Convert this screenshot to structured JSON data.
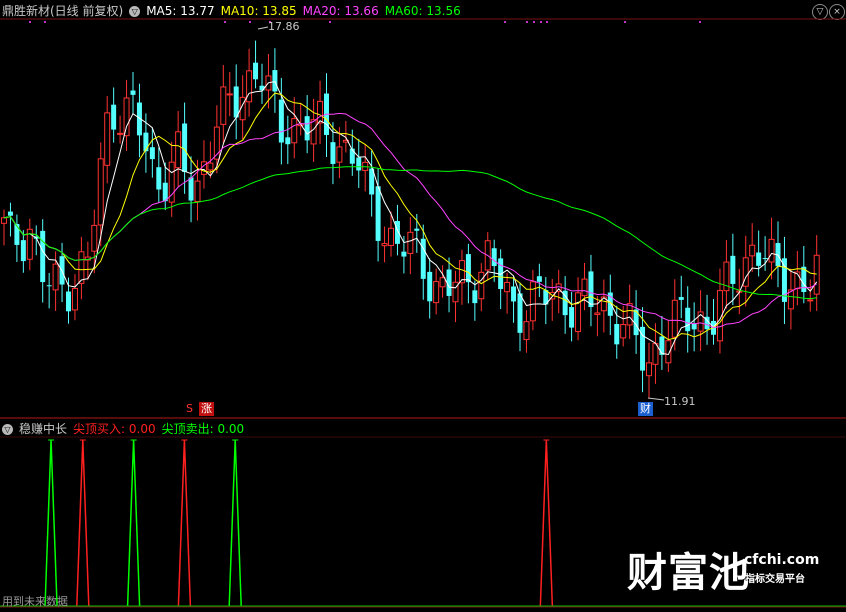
{
  "header": {
    "title": "鼎胜新材(日线 前复权)",
    "ma5": "MA5: 13.77",
    "ma10": "MA10: 13.85",
    "ma20": "MA20: 13.66",
    "ma60": "MA60: 13.56",
    "ma5_color": "#ffffff",
    "ma10_color": "#ffff00",
    "ma20_color": "#ff44ff",
    "ma60_color": "#00ff00"
  },
  "controls": {
    "close_icon": "×",
    "dropdown_icon": "▽"
  },
  "annotations": {
    "high": "17.86",
    "low": "11.91",
    "zhang_badge": "涨",
    "cai_badge": "财",
    "s_badge": "S"
  },
  "indicator": {
    "name": "稳赚中长",
    "buy_label": "尖顶买入: 0.00",
    "sell_label": "尖顶卖出: 0.00",
    "buy_color": "#ff2020",
    "sell_color": "#00ff00",
    "note": "用到未来数据"
  },
  "watermark": {
    "brand": "财富池",
    "domain": "cfchi.com",
    "slogan": "指标交易平台"
  },
  "chart_data": {
    "type": "candlestick",
    "price_range": [
      11.5,
      18.2
    ],
    "price_high_label": 17.86,
    "price_low_label": 11.91,
    "ma_series": [
      "MA5",
      "MA10",
      "MA20",
      "MA60"
    ],
    "indicator_spikes": [
      {
        "index": 3,
        "color": "green"
      },
      {
        "index": 8,
        "color": "red"
      },
      {
        "index": 16,
        "color": "green"
      },
      {
        "index": 24,
        "color": "red"
      },
      {
        "index": 32,
        "color": "green"
      },
      {
        "index": 81,
        "color": "red"
      }
    ]
  }
}
